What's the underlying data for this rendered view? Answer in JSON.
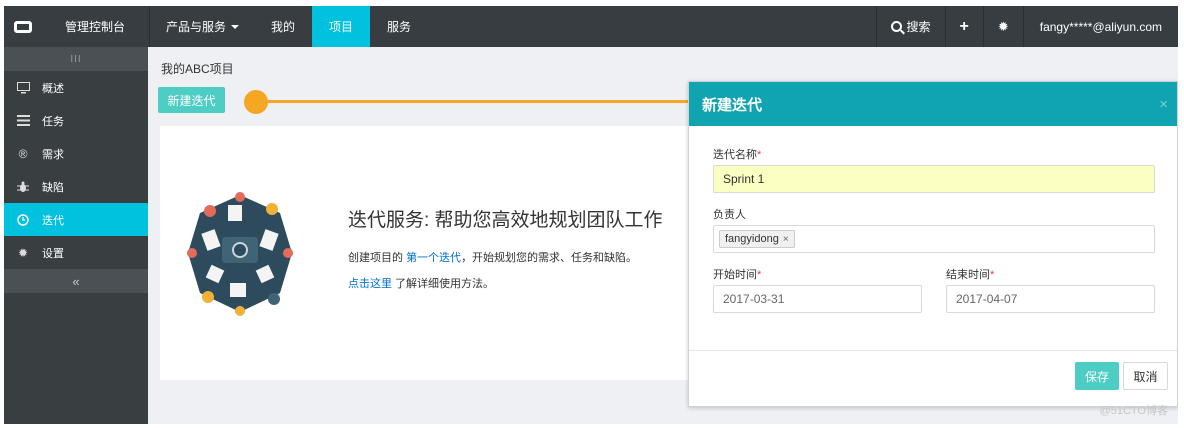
{
  "topnav": {
    "console": "管理控制台",
    "products": "产品与服务",
    "mine": "我的",
    "project": "项目",
    "service": "服务",
    "search": "搜索",
    "user": "fangy*****@aliyun.com"
  },
  "sidebar": {
    "handle": "III",
    "items": [
      {
        "label": "概述",
        "icon": "monitor-icon"
      },
      {
        "label": "任务",
        "icon": "list-icon"
      },
      {
        "label": "需求",
        "icon": "registered-icon"
      },
      {
        "label": "缺陷",
        "icon": "bug-icon"
      },
      {
        "label": "迭代",
        "icon": "clock-icon"
      },
      {
        "label": "设置",
        "icon": "gear-icon"
      }
    ],
    "collapse": "«"
  },
  "main": {
    "project_title": "我的ABC项目",
    "new_iteration_button": "新建迭代",
    "panel_title": "迭代服务: 帮助您高效地规划团队工作",
    "desc_prefix": "创建项目的",
    "desc_link": "第一个迭代",
    "desc_suffix": "，开始规划您的需求、任务和缺陷。",
    "hint_link": "点击这里",
    "hint_suffix": "了解详细使用方法。"
  },
  "modal": {
    "title": "新建迭代",
    "close": "×",
    "name_label": "迭代名称",
    "name_value": "Sprint 1",
    "owner_label": "负责人",
    "owner_tag": "fangyidong",
    "owner_tag_remove": "×",
    "start_label": "开始时间",
    "start_value": "2017-03-31",
    "end_label": "结束时间",
    "end_value": "2017-04-07",
    "required_mark": "*",
    "save": "保存",
    "cancel": "取消"
  },
  "watermark": "@51CTO博客",
  "colors": {
    "accent": "#00c1de",
    "button": "#4ecdc4",
    "modal_header": "#0fa4b0",
    "pointer": "#f5a623",
    "nav_bg": "#373d41"
  }
}
